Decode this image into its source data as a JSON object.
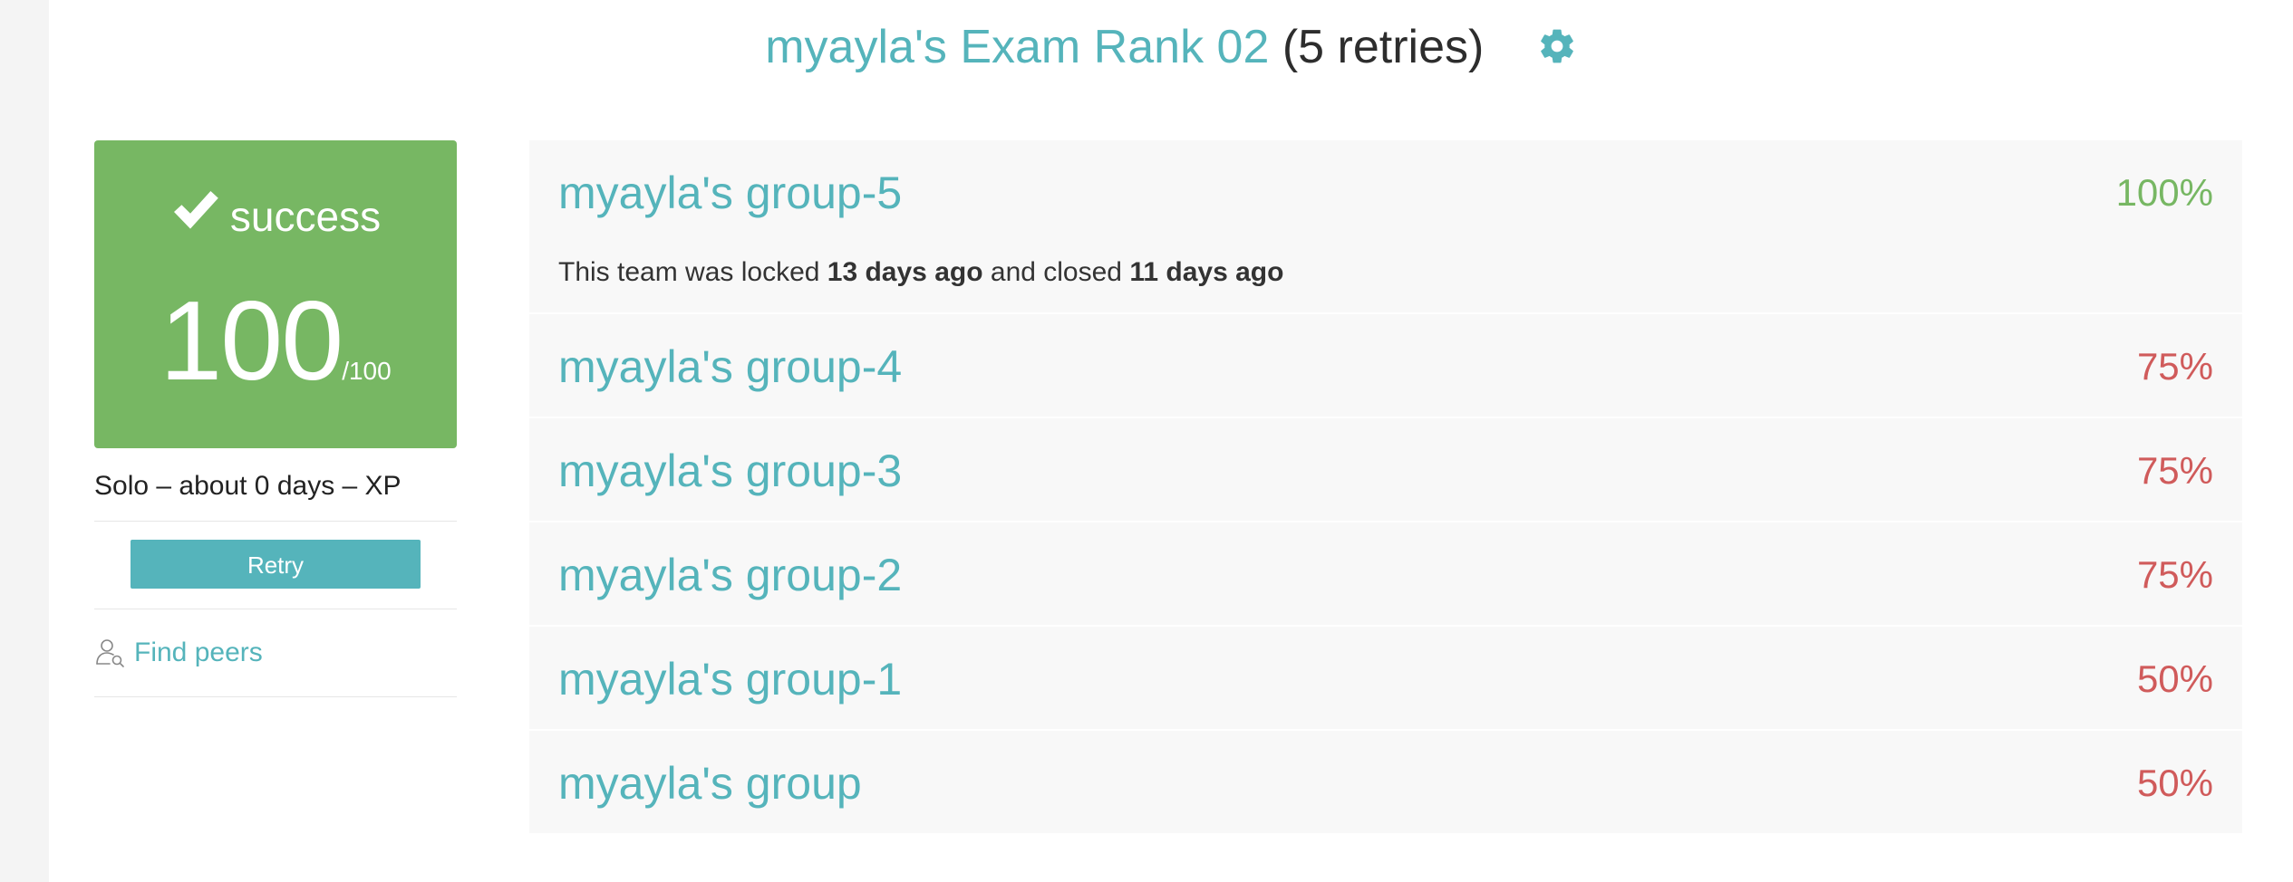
{
  "header": {
    "title": "myayla's Exam Rank 02",
    "retries": "(5 retries)",
    "settings_icon": "gear-icon"
  },
  "score_card": {
    "status_icon": "check-icon",
    "status": "success",
    "score": "100",
    "max": "/100",
    "color": "#77b763"
  },
  "meta": "Solo – about 0 days – XP",
  "actions": {
    "retry_label": "Retry",
    "find_peers_label": "Find peers",
    "find_peers_icon": "person-search-icon"
  },
  "groups": [
    {
      "name": "myayla's group-5",
      "percent": "100%",
      "passed": true,
      "note": {
        "prefix": "This team was locked ",
        "locked": "13 days ago",
        "middle": " and closed ",
        "closed": "11 days ago"
      }
    },
    {
      "name": "myayla's group-4",
      "percent": "75%",
      "passed": false
    },
    {
      "name": "myayla's group-3",
      "percent": "75%",
      "passed": false
    },
    {
      "name": "myayla's group-2",
      "percent": "75%",
      "passed": false
    },
    {
      "name": "myayla's group-1",
      "percent": "50%",
      "passed": false
    },
    {
      "name": "myayla's group",
      "percent": "50%",
      "passed": false
    }
  ],
  "colors": {
    "accent": "#55b4bb",
    "success": "#77b763",
    "fail": "#d05b5b"
  }
}
